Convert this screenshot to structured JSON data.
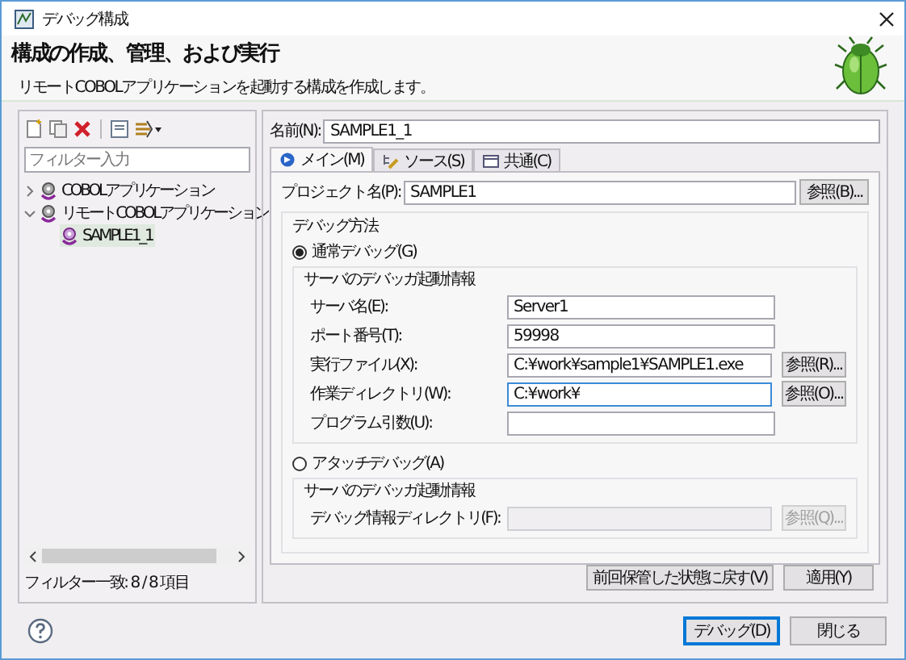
{
  "window": {
    "title": "デバッグ構成"
  },
  "header": {
    "title": "構成の作成、管理、および実行",
    "subtitle": "リモートCOBOLアプリケーションを起動する構成を作成します。"
  },
  "sidebar": {
    "filter": {
      "placeholder": "フィルター入力"
    },
    "tree": [
      {
        "label": "COBOLアプリケーション",
        "expanded": false,
        "selected": false
      },
      {
        "label": "リモートCOBOLアプリケーション",
        "expanded": true,
        "selected": false,
        "children": [
          {
            "label": "SAMPLE1_1",
            "selected": true
          }
        ]
      }
    ],
    "status": "フィルター一致: 8 / 8 項目"
  },
  "name_field": {
    "label": "名前(N):",
    "value": "SAMPLE1_1"
  },
  "tabs": [
    {
      "label": "メイン(M)",
      "selected": true,
      "kind": "main"
    },
    {
      "label": "ソース(S)",
      "selected": false,
      "kind": "source"
    },
    {
      "label": "共通(C)",
      "selected": false,
      "kind": "common"
    }
  ],
  "project": {
    "label": "プロジェクト名(P):",
    "value": "SAMPLE1",
    "button": "参照(B)..."
  },
  "debug_method": {
    "title": "デバッグ方法",
    "options": [
      {
        "label": "通常デバッグ(G)",
        "selected": true,
        "group": {
          "title": "サーバのデバッガ起動情報",
          "fields": [
            {
              "label": "サーバ名(E):",
              "value": "Server1",
              "focused": false,
              "disabled": false
            },
            {
              "label": "ポート番号(T):",
              "value": "59998",
              "focused": false,
              "disabled": false
            },
            {
              "label": "実行ファイル(X):",
              "value": "C:¥work¥sample1¥SAMPLE1.exe",
              "button": "参照(R)...",
              "focused": false,
              "disabled": false
            },
            {
              "label": "作業ディレクトリ(W):",
              "value": "C:¥work¥",
              "button": "参照(O)...",
              "focused": true,
              "disabled": false
            },
            {
              "label": "プログラム引数(U):",
              "focused": false,
              "disabled": false
            }
          ]
        }
      },
      {
        "label": "アタッチデバッグ(A)",
        "selected": false,
        "group": {
          "title": "サーバのデバッガ起動情報",
          "fields": [
            {
              "label": "デバッグ情報ディレクトリ(F):",
              "button": "参照(Q)...",
              "focused": false,
              "disabled": true
            }
          ]
        }
      }
    ]
  },
  "actions": {
    "revert": "前回保管した状態に戻す(V)",
    "apply": "適用(Y)"
  },
  "footer": {
    "buttons": [
      {
        "label": "デバッグ(D)",
        "default": true
      },
      {
        "label": "閉じる",
        "default": false
      }
    ]
  }
}
